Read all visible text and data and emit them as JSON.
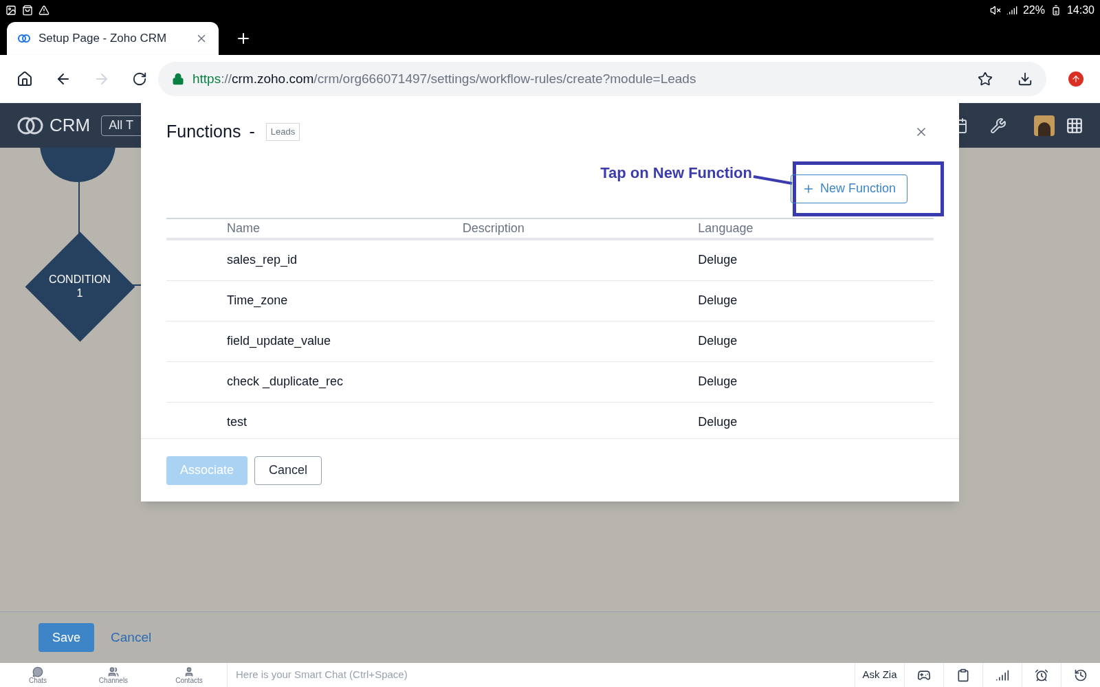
{
  "status_bar": {
    "battery": "22%",
    "time": "14:30"
  },
  "browser": {
    "tab": {
      "title": "Setup Page - Zoho CRM",
      "selected": true
    },
    "url": {
      "scheme": "https",
      "separator": "://",
      "host": "crm.zoho.com",
      "path": "/crm/org666071497/settings/workflow-rules/create?module=Leads"
    }
  },
  "app_header": {
    "logo": "CRM",
    "search_scope": "All T"
  },
  "canvas": {
    "nodes": [
      {
        "kind": "circle"
      },
      {
        "kind": "diamond",
        "label": "CONDITION\n1"
      }
    ]
  },
  "dialog": {
    "title": "Functions",
    "separator": "-",
    "module_badge": "Leads",
    "new_button": "New Function",
    "annotation": "Tap on New Function",
    "table": {
      "columns": [
        "Name",
        "Description",
        "Language"
      ],
      "rows": [
        {
          "name": "sales_rep_id",
          "language": "Deluge"
        },
        {
          "name": "Time_zone",
          "language": "Deluge"
        },
        {
          "name": "field_update_value",
          "language": "Deluge"
        },
        {
          "name": "check _duplicate_rec",
          "language": "Deluge"
        },
        {
          "name": "test",
          "language": "Deluge"
        }
      ]
    },
    "buttons": [
      {
        "label": "Associate",
        "kind": "primary",
        "disabled": true
      },
      {
        "label": "Cancel",
        "kind": "secondary",
        "disabled": false
      }
    ]
  },
  "footer": {
    "save": "Save",
    "cancel": "Cancel"
  },
  "chat_bar": {
    "items": [
      {
        "label": "Chats",
        "kind": "chat"
      },
      {
        "label": "Channels",
        "kind": "channels"
      },
      {
        "label": "Contacts",
        "kind": "contacts"
      }
    ],
    "placeholder": "Here is your Smart Chat (Ctrl+Space)",
    "ask": "Ask Zia"
  }
}
